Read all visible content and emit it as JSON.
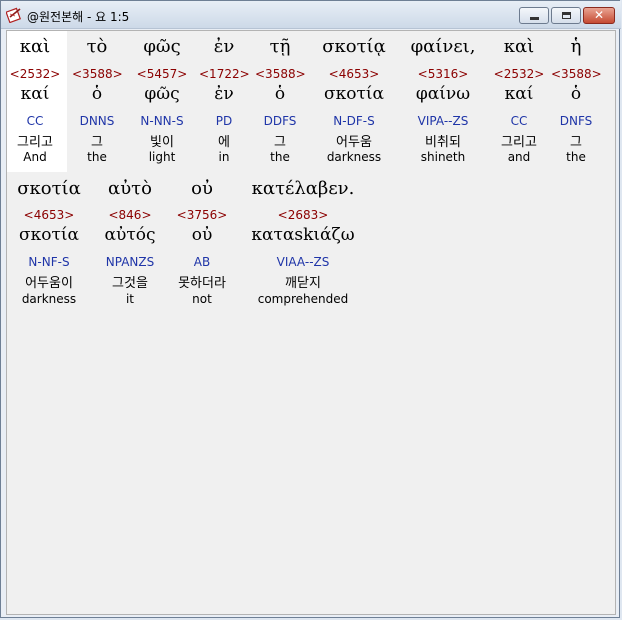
{
  "window": {
    "title": "@원전본해 - 요 1:5"
  },
  "icons": {
    "app": "book-pen-icon",
    "minimize": "minimize-icon",
    "maximize": "maximize-icon",
    "close": "close-icon"
  },
  "words": [
    {
      "greek": "καὶ",
      "strong": "<2532>",
      "lemma": "καί",
      "morph": "CC",
      "korean": "그리고",
      "english": "And"
    },
    {
      "greek": "τὸ",
      "strong": "<3588>",
      "lemma": "ὁ",
      "morph": "DNNS",
      "korean": "그",
      "english": "the"
    },
    {
      "greek": "φῶς",
      "strong": "<5457>",
      "lemma": "φῶς",
      "morph": "N-NN-S",
      "korean": "빛이",
      "english": "light"
    },
    {
      "greek": "ἐν",
      "strong": "<1722>",
      "lemma": "ἐν",
      "morph": "PD",
      "korean": "에",
      "english": "in"
    },
    {
      "greek": "τῇ",
      "strong": "<3588>",
      "lemma": "ὁ",
      "morph": "DDFS",
      "korean": "그",
      "english": "the"
    },
    {
      "greek": "σκοτίᾳ",
      "strong": "<4653>",
      "lemma": "σκοτία",
      "morph": "N-DF-S",
      "korean": "어두움",
      "english": "darkness"
    },
    {
      "greek": "φαίνει,",
      "strong": "<5316>",
      "lemma": "φαίνω",
      "morph": "VIPA--ZS",
      "korean": "비취되",
      "english": "shineth"
    },
    {
      "greek": "καὶ",
      "strong": "<2532>",
      "lemma": "καί",
      "morph": "CC",
      "korean": "그리고",
      "english": "and"
    },
    {
      "greek": "ἡ",
      "strong": "<3588>",
      "lemma": "ὁ",
      "morph": "DNFS",
      "korean": "그",
      "english": "the"
    },
    {
      "greek": "σκοτία",
      "strong": "<4653>",
      "lemma": "σκοτία",
      "morph": "N-NF-S",
      "korean": "어두움이",
      "english": "darkness"
    },
    {
      "greek": "αὐτὸ",
      "strong": "<846>",
      "lemma": "αὐτός",
      "morph": "NPANZS",
      "korean": "그것을",
      "english": "it"
    },
    {
      "greek": "οὐ",
      "strong": "<3756>",
      "lemma": "οὐ",
      "morph": "AB",
      "korean": "못하더라",
      "english": "not"
    },
    {
      "greek": "κατέλαβεν.",
      "strong": "<2683>",
      "lemma": "καταskιάζω",
      "morph": "VIAA--ZS",
      "korean": "깨닫지",
      "english": "comprehended"
    }
  ]
}
